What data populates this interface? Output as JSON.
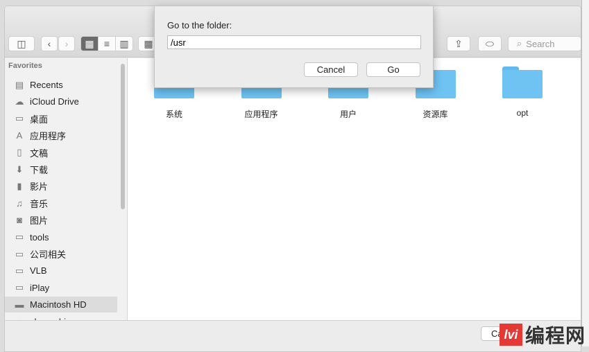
{
  "toolbar": {
    "search_placeholder": "Search"
  },
  "sidebar": {
    "heading": "Favorites",
    "items": [
      {
        "label": "Recents",
        "icon": "recents-icon"
      },
      {
        "label": "iCloud Drive",
        "icon": "cloud-icon"
      },
      {
        "label": "桌面",
        "icon": "desktop-icon"
      },
      {
        "label": "应用程序",
        "icon": "applications-icon"
      },
      {
        "label": "文稿",
        "icon": "document-icon"
      },
      {
        "label": "下载",
        "icon": "download-icon"
      },
      {
        "label": "影片",
        "icon": "film-icon"
      },
      {
        "label": "音乐",
        "icon": "music-icon"
      },
      {
        "label": "图片",
        "icon": "camera-icon"
      },
      {
        "label": "tools",
        "icon": "folder-icon"
      },
      {
        "label": "公司相关",
        "icon": "folder-icon"
      },
      {
        "label": "VLB",
        "icon": "folder-icon"
      },
      {
        "label": "iPlay",
        "icon": "folder-icon"
      },
      {
        "label": "Macintosh HD",
        "icon": "disk-icon",
        "selected": true
      },
      {
        "label": "zhangzhi",
        "icon": "home-icon"
      }
    ]
  },
  "content": {
    "items": [
      "系统",
      "应用程序",
      "用户",
      "资源库",
      "opt"
    ]
  },
  "bottom": {
    "cancel_label": "Ca"
  },
  "dialog": {
    "title": "Go to the folder:",
    "value": "/usr",
    "cancel_label": "Cancel",
    "go_label": "Go"
  },
  "watermark": {
    "text": "编程网",
    "mark": "lvi"
  },
  "colors": {
    "folder": "#6ec3f3",
    "selection": "#dcdcdc"
  }
}
